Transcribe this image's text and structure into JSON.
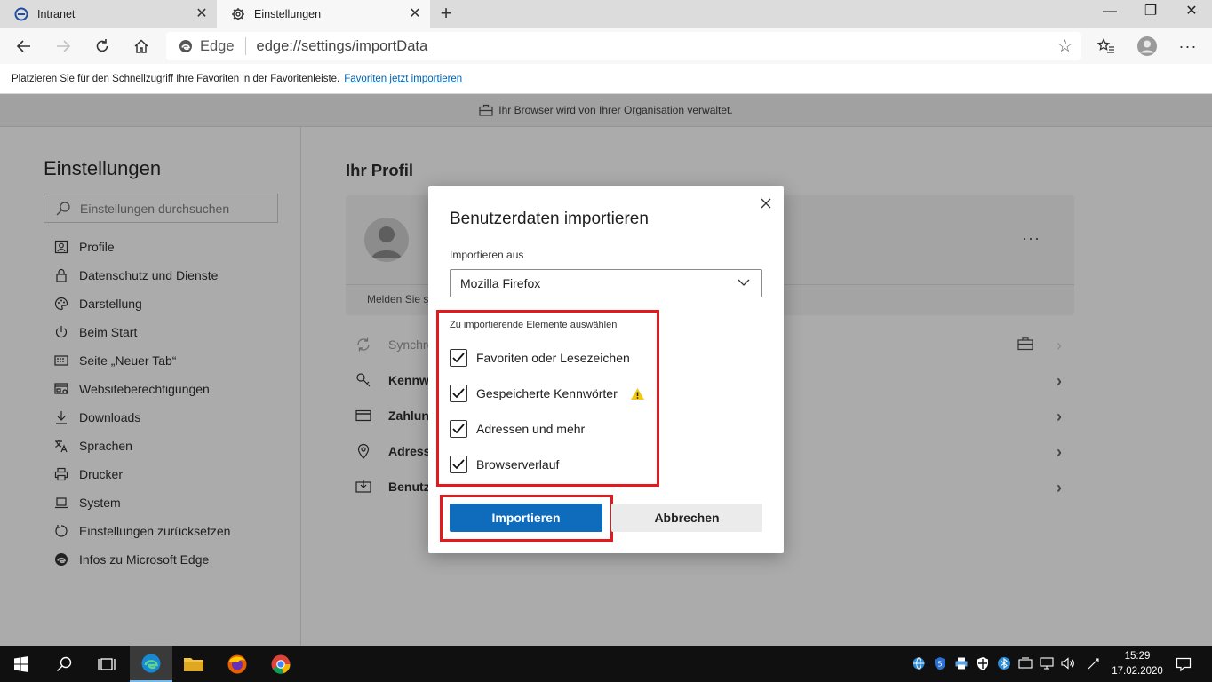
{
  "browser": {
    "tabs": [
      {
        "title": "Intranet",
        "icon": "ie-icon",
        "active": false
      },
      {
        "title": "Einstellungen",
        "icon": "gear-icon",
        "active": true
      }
    ],
    "address": {
      "badge": "Edge",
      "url": "edge://settings/importData"
    },
    "favorites_bar": {
      "text": "Platzieren Sie für den Schnellzugriff Ihre Favoriten in der Favoritenleiste.",
      "link": "Favoriten jetzt importieren"
    },
    "managed_notice": "Ihr Browser wird von Ihrer Organisation verwaltet."
  },
  "settings": {
    "title": "Einstellungen",
    "search_placeholder": "Einstellungen durchsuchen",
    "nav": [
      {
        "label": "Profile",
        "icon": "profile-icon"
      },
      {
        "label": "Datenschutz und Dienste",
        "icon": "lock-icon"
      },
      {
        "label": "Darstellung",
        "icon": "palette-icon"
      },
      {
        "label": "Beim Start",
        "icon": "power-icon"
      },
      {
        "label": "Seite „Neuer Tab“",
        "icon": "newtab-page-icon"
      },
      {
        "label": "Websiteberechtigungen",
        "icon": "site-permissions-icon"
      },
      {
        "label": "Downloads",
        "icon": "download-icon"
      },
      {
        "label": "Sprachen",
        "icon": "languages-icon"
      },
      {
        "label": "Drucker",
        "icon": "printer-icon"
      },
      {
        "label": "System",
        "icon": "laptop-icon"
      },
      {
        "label": "Einstellungen zurücksetzen",
        "icon": "reset-icon"
      },
      {
        "label": "Infos zu Microsoft Edge",
        "icon": "edge-icon"
      }
    ],
    "profile": {
      "heading": "Ihr Profil",
      "signin_text": "Melden Sie si",
      "rows": [
        {
          "label": "Synchro",
          "icon": "sync-icon"
        },
        {
          "label": "Kennwo",
          "icon": "key-icon"
        },
        {
          "label": "Zahlun",
          "icon": "card-icon"
        },
        {
          "label": "Adresse",
          "icon": "location-icon"
        },
        {
          "label": "Benutz",
          "icon": "import-icon"
        }
      ]
    }
  },
  "dialog": {
    "title": "Benutzerdaten importieren",
    "import_from_label": "Importieren aus",
    "source": "Mozilla Firefox",
    "items_label": "Zu importierende Elemente auswählen",
    "items": [
      {
        "label": "Favoriten oder Lesezeichen",
        "checked": true
      },
      {
        "label": "Gespeicherte Kennwörter",
        "checked": true,
        "warning": true
      },
      {
        "label": "Adressen und mehr",
        "checked": true
      },
      {
        "label": "Browserverlauf",
        "checked": true
      }
    ],
    "primary_button": "Importieren",
    "secondary_button": "Abbrechen"
  },
  "taskbar": {
    "time": "15:29",
    "date": "17.02.2020"
  },
  "colors": {
    "accent": "#0f6cbd",
    "highlight": "#e3191d",
    "warning": "#f2c811"
  }
}
